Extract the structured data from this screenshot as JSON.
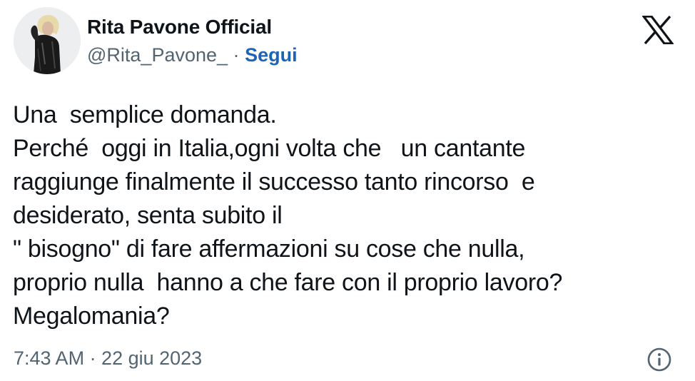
{
  "author": {
    "display_name": "Rita Pavone Official",
    "handle": "@Rita_Pavone_",
    "separator": "·",
    "follow_label": "Segui",
    "avatar": "profile-photo"
  },
  "platform_icon": "x-logo-icon",
  "tweet": {
    "text": "Una  semplice domanda.\nPerché  oggi in Italia,ogni volta che   un cantante\nraggiunge finalmente il successo tanto rincorso  e\ndesiderato, senta subito il\n\" bisogno\" di fare affermazioni su cose che nulla,\nproprio nulla  hanno a che fare con il proprio lavoro?\nMegalomania?",
    "timestamp": "7:43 AM · 22 giu 2023"
  },
  "footer": {
    "info_icon": "info-icon"
  },
  "colors": {
    "text": "#0f1419",
    "secondary": "#536471",
    "link": "#1d63b8"
  }
}
